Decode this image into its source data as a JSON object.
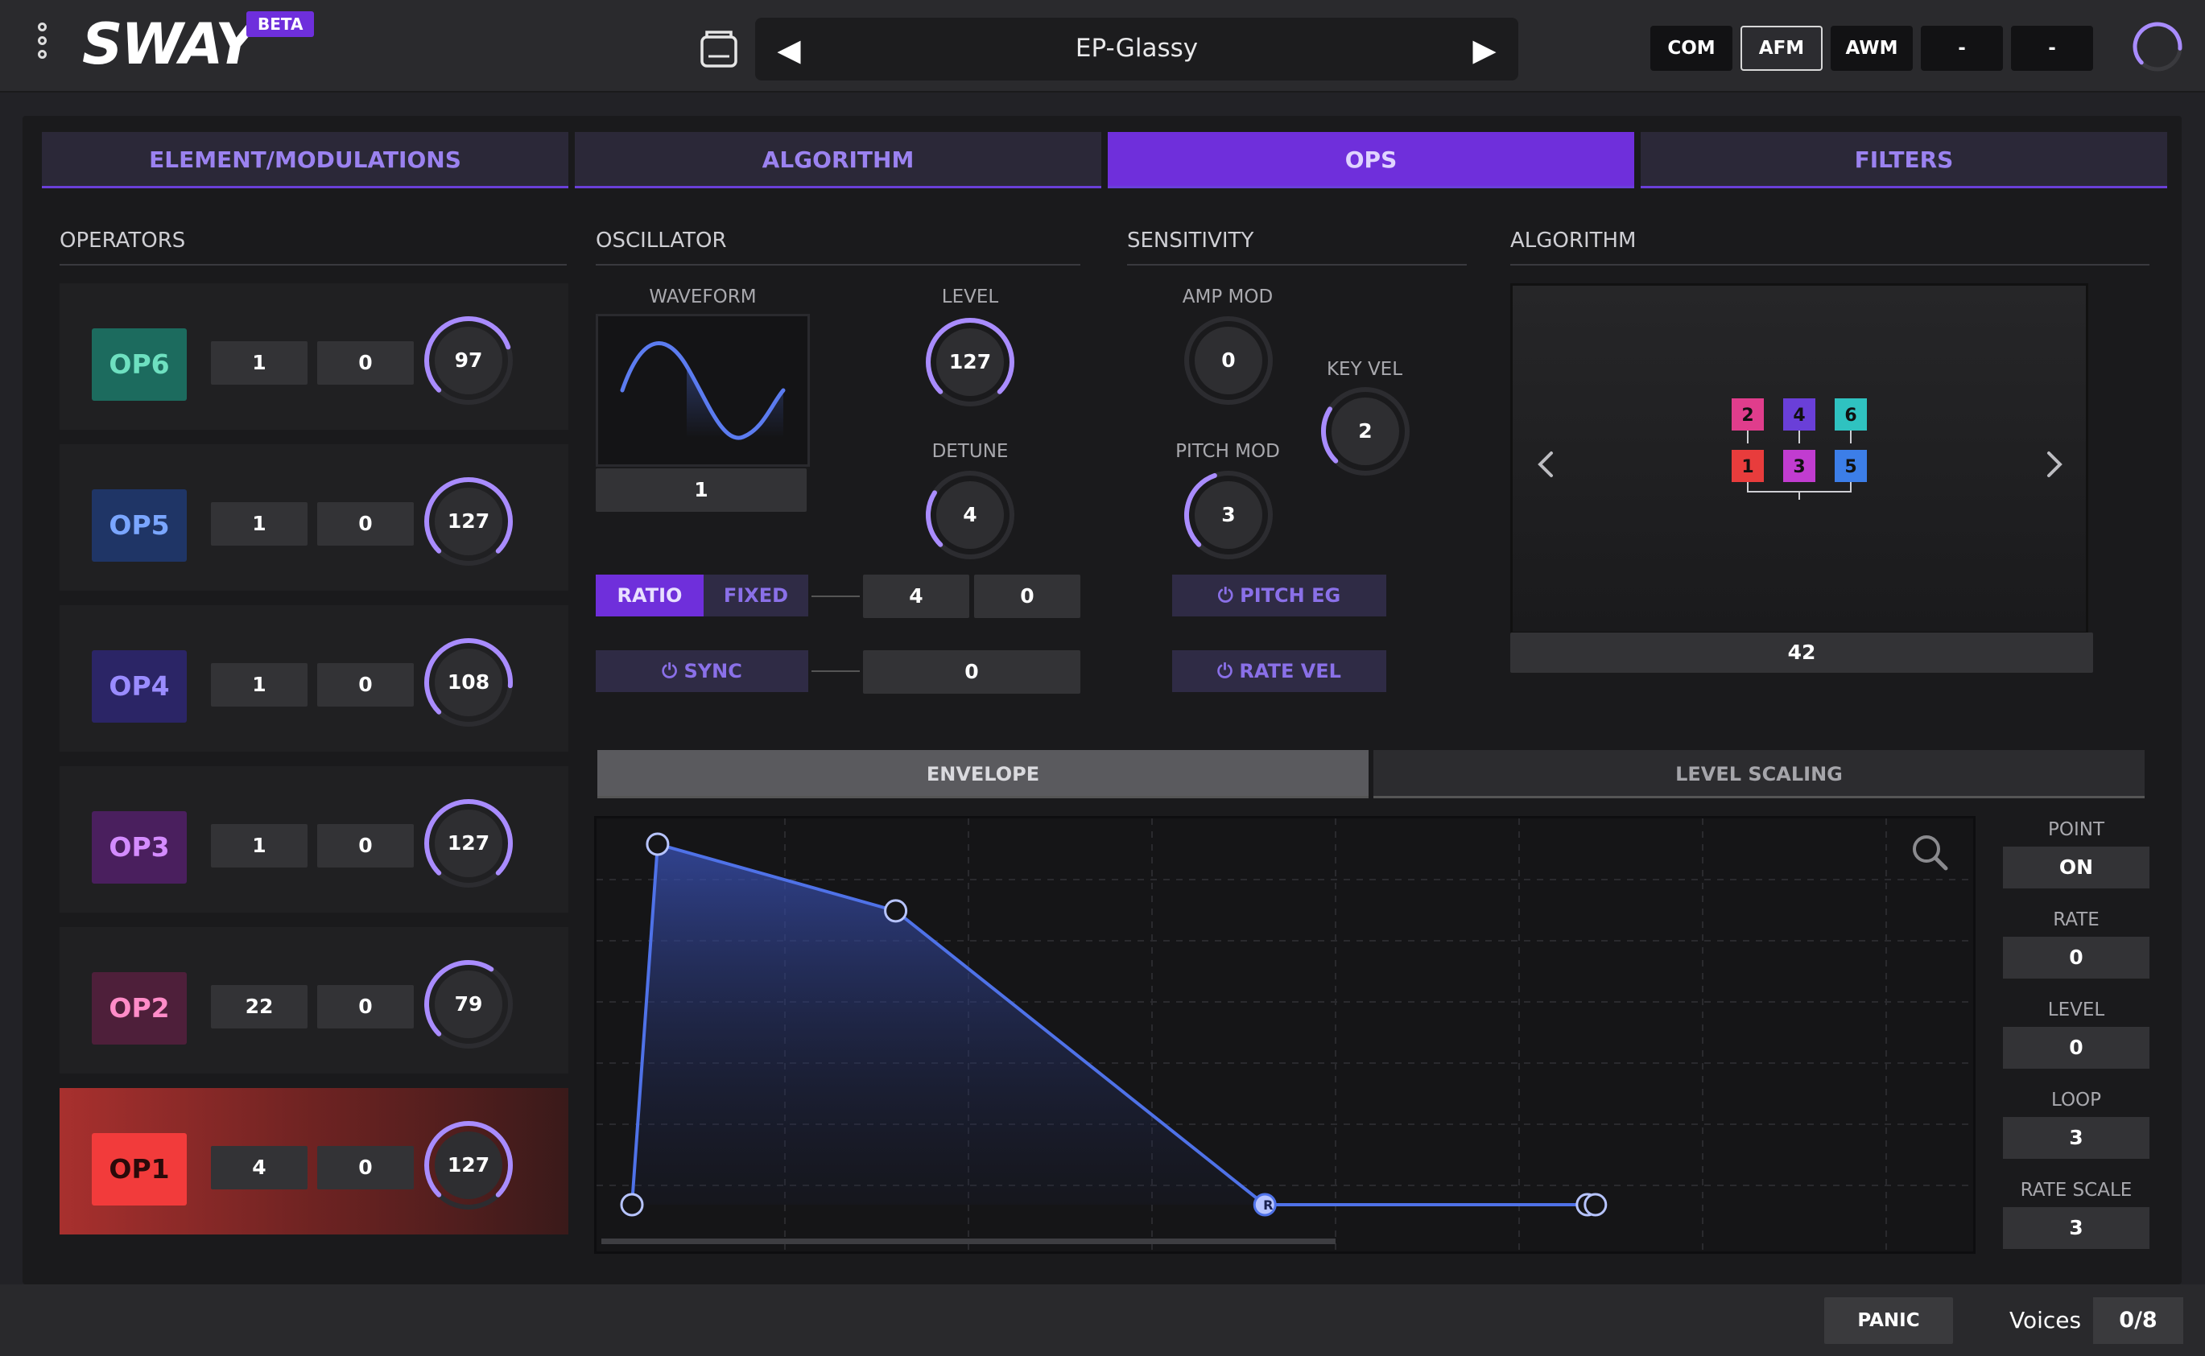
{
  "header": {
    "logo": "SWAY",
    "badge": "BETA",
    "preset_name": "EP-Glassy",
    "prev_icon": "triangle-left-icon",
    "next_icon": "triangle-right-icon",
    "modes": [
      {
        "label": "COM",
        "active": false
      },
      {
        "label": "AFM",
        "active": true
      },
      {
        "label": "AWM",
        "active": false
      },
      {
        "label": "-",
        "active": false
      },
      {
        "label": "-",
        "active": false
      }
    ],
    "master_knob_level": 0.85
  },
  "tabs": [
    {
      "label": "ELEMENT/MODULATIONS",
      "active": false
    },
    {
      "label": "ALGORITHM",
      "active": false
    },
    {
      "label": "OPS",
      "active": true
    },
    {
      "label": "FILTERS",
      "active": false
    }
  ],
  "sections": {
    "operators": "OPERATORS",
    "oscillator": "OSCILLATOR",
    "sensitivity": "SENSITIVITY",
    "algorithm": "ALGORITHM"
  },
  "operators": [
    {
      "label": "OP6",
      "ratio": "1",
      "detune": "0",
      "level": "97",
      "level_value": 97,
      "color": "#1c6b5e",
      "text_color": "#6ee0c0"
    },
    {
      "label": "OP5",
      "ratio": "1",
      "detune": "0",
      "level": "127",
      "level_value": 127,
      "color": "#1f3566",
      "text_color": "#7aa6ff"
    },
    {
      "label": "OP4",
      "ratio": "1",
      "detune": "0",
      "level": "108",
      "level_value": 108,
      "color": "#2b2566",
      "text_color": "#9a8cff"
    },
    {
      "label": "OP3",
      "ratio": "1",
      "detune": "0",
      "level": "127",
      "level_value": 127,
      "color": "#4a1f5e",
      "text_color": "#d48cff"
    },
    {
      "label": "OP2",
      "ratio": "22",
      "detune": "0",
      "level": "79",
      "level_value": 79,
      "color": "#4e1f3a",
      "text_color": "#ff8cc8"
    },
    {
      "label": "OP1",
      "ratio": "4",
      "detune": "0",
      "level": "127",
      "level_value": 127,
      "color": "#f23b3b",
      "text_color": "#2a0a0a",
      "selected": true
    }
  ],
  "oscillator": {
    "waveform_label": "WAVEFORM",
    "waveform_value": "1",
    "level_label": "LEVEL",
    "level_value": "127",
    "level_num": 127,
    "detune_label": "DETUNE",
    "detune_value": "4",
    "detune_num": 4,
    "ratio_label": "RATIO",
    "fixed_label": "FIXED",
    "ratio_coarse": "4",
    "ratio_fine": "0",
    "sync_label": "SYNC",
    "sync_value": "0",
    "power_icon": "power-icon"
  },
  "sensitivity": {
    "amp_mod_label": "AMP MOD",
    "amp_mod_value": "0",
    "amp_mod_num": 0,
    "key_vel_label": "KEY VEL",
    "key_vel_value": "2",
    "key_vel_num": 2,
    "pitch_mod_label": "PITCH MOD",
    "pitch_mod_value": "3",
    "pitch_mod_num": 3,
    "pitch_eg_label": "PITCH EG",
    "rate_vel_label": "RATE VEL"
  },
  "algorithm": {
    "value": "42",
    "prev_icon": "chevron-left-icon",
    "next_icon": "chevron-right-icon",
    "ops": [
      {
        "label": "2",
        "color": "#e03d8c"
      },
      {
        "label": "4",
        "color": "#6a3fd8"
      },
      {
        "label": "6",
        "color": "#2fc2c0"
      },
      {
        "label": "1",
        "color": "#e83c3c"
      },
      {
        "label": "3",
        "color": "#c13cd0"
      },
      {
        "label": "5",
        "color": "#3c7ee8"
      }
    ]
  },
  "envelope": {
    "tabs": [
      {
        "label": "ENVELOPE",
        "active": true
      },
      {
        "label": "LEVEL SCALING",
        "active": false
      }
    ],
    "zoom_icon": "magnifier-icon",
    "release_marker": "R",
    "points": [
      {
        "t": 0.0,
        "level": 0.0
      },
      {
        "t": 0.019,
        "level": 1.0
      },
      {
        "t": 0.195,
        "level": 0.815
      },
      {
        "t": 0.468,
        "level": 0.0
      },
      {
        "t": 0.71,
        "level": 0.0
      }
    ],
    "side": [
      {
        "label": "POINT",
        "value": "ON"
      },
      {
        "label": "RATE",
        "value": "0"
      },
      {
        "label": "LEVEL",
        "value": "0"
      },
      {
        "label": "LOOP",
        "value": "3"
      },
      {
        "label": "RATE SCALE",
        "value": "3"
      }
    ],
    "accent": "#4f72e8"
  },
  "footer": {
    "panic": "PANIC",
    "voices_label": "Voices",
    "voices_value": "0/8"
  }
}
